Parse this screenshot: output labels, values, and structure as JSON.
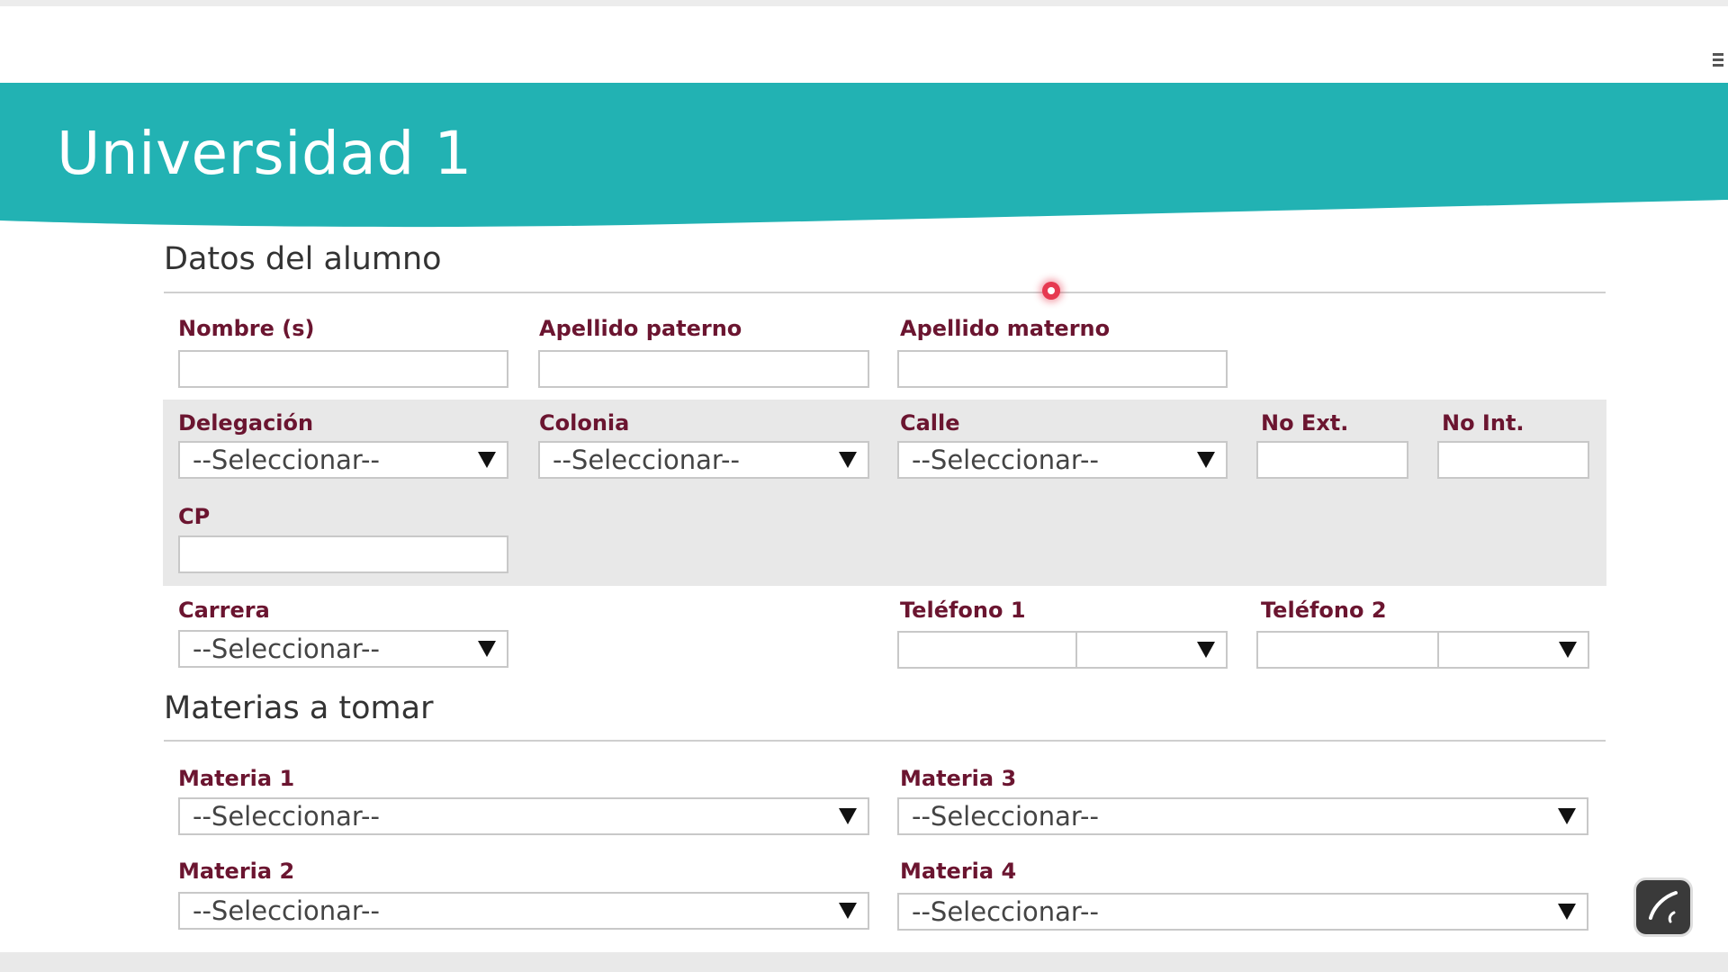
{
  "banner": {
    "title": "Universidad 1",
    "color": "#22b2b3"
  },
  "student_section": {
    "title": "Datos del alumno",
    "fields": {
      "nombre": {
        "label": "Nombre (s)",
        "value": ""
      },
      "apellido_paterno": {
        "label": "Apellido paterno",
        "value": ""
      },
      "apellido_materno": {
        "label": "Apellido materno",
        "value": ""
      },
      "delegacion": {
        "label": "Delegación",
        "selected": "--Seleccionar--"
      },
      "colonia": {
        "label": "Colonia",
        "selected": "--Seleccionar--"
      },
      "calle": {
        "label": "Calle",
        "selected": "--Seleccionar--"
      },
      "no_ext": {
        "label": "No Ext.",
        "value": ""
      },
      "no_int": {
        "label": "No Int.",
        "value": ""
      },
      "cp": {
        "label": "CP",
        "value": ""
      },
      "carrera": {
        "label": "Carrera",
        "selected": "--Seleccionar--"
      },
      "telefono1": {
        "label": "Teléfono 1",
        "value": "",
        "type_selected": ""
      },
      "telefono2": {
        "label": "Teléfono 2",
        "value": "",
        "type_selected": ""
      }
    }
  },
  "subjects_section": {
    "title": "Materias a tomar",
    "fields": {
      "materia1": {
        "label": "Materia 1",
        "selected": "--Seleccionar--"
      },
      "materia2": {
        "label": "Materia 2",
        "selected": "--Seleccionar--"
      },
      "materia3": {
        "label": "Materia 3",
        "selected": "--Seleccionar--"
      },
      "materia4": {
        "label": "Materia 4",
        "selected": "--Seleccionar--"
      }
    }
  },
  "icons": {
    "menu": "hamburger-menu-icon",
    "dropdown": "triangle-down-icon",
    "cursor": "red-cursor-dot-icon",
    "edit": "pen-edit-icon"
  },
  "colors": {
    "label": "#6b1530",
    "panel": "#e8e8e8",
    "accent": "#22b2b3"
  }
}
